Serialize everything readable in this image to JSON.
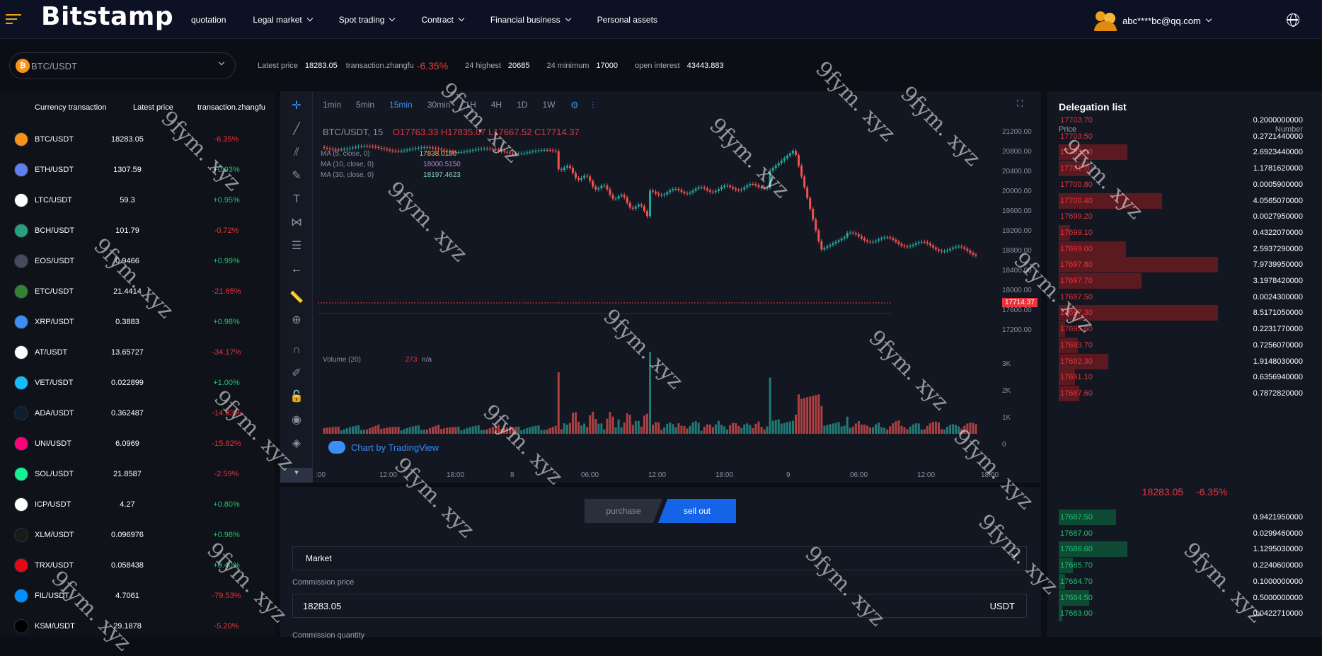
{
  "header": {
    "logo": "Bitstamp",
    "nav": [
      "quotation",
      "Legal market",
      "Spot trading",
      "Contract",
      "Financial business",
      "Personal assets"
    ],
    "user_email": "abc****bc@qq.com"
  },
  "ticker": {
    "pair": "BTC/USDT",
    "latest_price_label": "Latest price",
    "latest_price": "18283.05",
    "change_label": "transaction.zhangfu",
    "change": "-6.35%",
    "high_label": "24 highest",
    "high": "20685",
    "low_label": "24 minimum",
    "low": "17000",
    "oi_label": "open interest",
    "oi": "43443.883"
  },
  "market_list": {
    "headers": [
      "Currency transaction",
      "Latest price",
      "transaction.zhangfu"
    ],
    "rows": [
      {
        "sym": "BTC/USDT",
        "price": "18283.05",
        "chg": "-6.35%",
        "dir": "down",
        "color": "#f7931a"
      },
      {
        "sym": "ETH/USDT",
        "price": "1307.59",
        "chg": "+0.93%",
        "dir": "up",
        "color": "#627eea"
      },
      {
        "sym": "LTC/USDT",
        "price": "59.3",
        "chg": "+0.95%",
        "dir": "up",
        "color": "#ffffff"
      },
      {
        "sym": "BCH/USDT",
        "price": "101.79",
        "chg": "-0.72%",
        "dir": "down",
        "color": "#26a17b"
      },
      {
        "sym": "EOS/USDT",
        "price": "0.9466",
        "chg": "+0.99%",
        "dir": "up",
        "color": "#444b5a"
      },
      {
        "sym": "ETC/USDT",
        "price": "21.4414",
        "chg": "-21.65%",
        "dir": "down",
        "color": "#328332"
      },
      {
        "sym": "XRP/USDT",
        "price": "0.3883",
        "chg": "+0.98%",
        "dir": "up",
        "color": "#3a8ef6"
      },
      {
        "sym": "AT/USDT",
        "price": "13.65727",
        "chg": "-34.17%",
        "dir": "down",
        "color": "#ffffff"
      },
      {
        "sym": "VET/USDT",
        "price": "0.022899",
        "chg": "+1.00%",
        "dir": "up",
        "color": "#15bdff"
      },
      {
        "sym": "ADA/USDT",
        "price": "0.362487",
        "chg": "-14.83%",
        "dir": "down",
        "color": "#0d1e30"
      },
      {
        "sym": "UNI/USDT",
        "price": "6.0969",
        "chg": "-15.82%",
        "dir": "down",
        "color": "#ff007a"
      },
      {
        "sym": "SOL/USDT",
        "price": "21.8587",
        "chg": "-2.59%",
        "dir": "down",
        "color": "#14f195"
      },
      {
        "sym": "ICP/USDT",
        "price": "4.27",
        "chg": "+0.80%",
        "dir": "up",
        "color": "#ffffff"
      },
      {
        "sym": "XLM/USDT",
        "price": "0.096976",
        "chg": "+0.98%",
        "dir": "up",
        "color": "#1a1a1a"
      },
      {
        "sym": "TRX/USDT",
        "price": "0.058438",
        "chg": "+0.40%",
        "dir": "up",
        "color": "#e50915"
      },
      {
        "sym": "FIL/USDT",
        "price": "4.7061",
        "chg": "-79.53%",
        "dir": "down",
        "color": "#0090ff"
      },
      {
        "sym": "KSM/USDT",
        "price": "29.1878",
        "chg": "-5.20%",
        "dir": "down",
        "color": "#000000"
      }
    ]
  },
  "chart": {
    "timeframes": [
      "1min",
      "5min",
      "15min",
      "30min",
      "1H",
      "4H",
      "1D",
      "1W"
    ],
    "active_timeframe": "15min",
    "symbol_interval": "BTC/USDT, 15",
    "ohlc": "O17763.33  H17835.07  L17667.52  C17714.37",
    "ma_rows": [
      {
        "label": "MA (5, close, 0)",
        "value": "17838.0180",
        "color": "#f0c060"
      },
      {
        "label": "MA (10, close, 0)",
        "value": "18000.5150",
        "color": "#b48ad8"
      },
      {
        "label": "MA (30, close, 0)",
        "value": "18197.4623",
        "color": "#7fd3c3"
      }
    ],
    "y_ticks": [
      "21200.00",
      "20800.00",
      "20400.00",
      "20000.00",
      "19600.00",
      "19200.00",
      "18800.00",
      "18400.00",
      "18000.00",
      "17600.00",
      "17200.00"
    ],
    "x_ticks": [
      ":00",
      "12:00",
      "18:00",
      "8",
      "06:00",
      "12:00",
      "18:00",
      "9",
      "06:00",
      "12:00",
      "18:00"
    ],
    "last_price_tag": "17714.37",
    "volume_label": "Volume (20)",
    "volume_value": "273",
    "volume_suffix": "n/a",
    "vol_ticks": [
      "3K",
      "2K",
      "1K",
      "0"
    ],
    "credit": "Chart by TradingView"
  },
  "order_form": {
    "buy_tab": "purchase",
    "sell_tab": "sell out",
    "order_type": "Market",
    "price_label": "Commission price",
    "price_value": "18283.05",
    "price_unit": "USDT",
    "qty_label": "Commission quantity"
  },
  "orderbook": {
    "title": "Delegation list",
    "col_price": "Price",
    "col_number": "Number",
    "asks": [
      {
        "p": "17703.70",
        "n": "0.2000000000",
        "depth": 0.0
      },
      {
        "p": "17703.50",
        "n": "0.2721440000",
        "depth": 0.0
      },
      {
        "p": "17703.00",
        "n": "2.6923440000",
        "depth": 0.43
      },
      {
        "p": "17701.70",
        "n": "1.1781620000",
        "depth": 0.19
      },
      {
        "p": "17700.80",
        "n": "0.0005900000",
        "depth": 0.0
      },
      {
        "p": "17700.40",
        "n": "4.0565070000",
        "depth": 0.65
      },
      {
        "p": "17699.20",
        "n": "0.0027950000",
        "depth": 0.0
      },
      {
        "p": "17699.10",
        "n": "0.4322070000",
        "depth": 0.07
      },
      {
        "p": "17699.00",
        "n": "2.5937290000",
        "depth": 0.42
      },
      {
        "p": "17697.80",
        "n": "7.9739950000",
        "depth": 1.0
      },
      {
        "p": "17697.70",
        "n": "3.1978420000",
        "depth": 0.52
      },
      {
        "p": "17697.50",
        "n": "0.0024300000",
        "depth": 0.0
      },
      {
        "p": "17697.30",
        "n": "8.5171050000",
        "depth": 1.0
      },
      {
        "p": "17695.60",
        "n": "0.2231770000",
        "depth": 0.04
      },
      {
        "p": "17693.70",
        "n": "0.7256070000",
        "depth": 0.12
      },
      {
        "p": "17692.30",
        "n": "1.9148030000",
        "depth": 0.31
      },
      {
        "p": "17691.10",
        "n": "0.6356940000",
        "depth": 0.1
      },
      {
        "p": "17687.60",
        "n": "0.7872820000",
        "depth": 0.13
      }
    ],
    "mid_price": "18283.05",
    "mid_change": "-6.35%",
    "bids": [
      {
        "p": "17687.50",
        "n": "0.9421950000",
        "depth": 0.36
      },
      {
        "p": "17687.00",
        "n": "0.0299460000",
        "depth": 0.0
      },
      {
        "p": "17686.60",
        "n": "1.1295030000",
        "depth": 0.43
      },
      {
        "p": "17685.70",
        "n": "0.2240600000",
        "depth": 0.09
      },
      {
        "p": "17684.70",
        "n": "0.1000000000",
        "depth": 0.04
      },
      {
        "p": "17684.50",
        "n": "0.5000000000",
        "depth": 0.19
      },
      {
        "p": "17683.00",
        "n": "0.0422710000",
        "depth": 0.02
      }
    ]
  },
  "watermark": "9fym. xyz",
  "colors": {
    "up": "#1ec26f",
    "down": "#e7343d",
    "accent": "#1564e8",
    "ask_bar": "#5a1a20",
    "bid_bar": "#0f4a35"
  }
}
